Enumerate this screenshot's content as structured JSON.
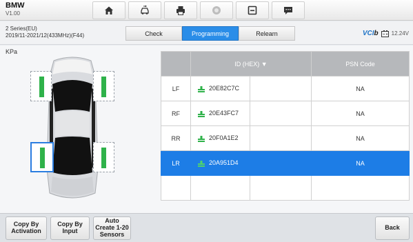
{
  "header": {
    "make": "BMW",
    "version": "V1.00",
    "toolbar": [
      {
        "name": "home-icon"
      },
      {
        "name": "vehicle-swap-icon"
      },
      {
        "name": "print-icon"
      },
      {
        "name": "help-icon"
      },
      {
        "name": "save-icon"
      },
      {
        "name": "message-icon"
      }
    ]
  },
  "vehicle": {
    "line1": "2 Series(EU)",
    "line2": "2019/11-2021/12(433MHz)(F44)"
  },
  "tabs": [
    {
      "label": "Check",
      "active": false
    },
    {
      "label": "Programming",
      "active": true
    },
    {
      "label": "Relearn",
      "active": false
    }
  ],
  "status": {
    "vci_label": "VCI",
    "vci_b": "b",
    "voltage": "12.24V"
  },
  "main": {
    "unit": "KPa"
  },
  "table": {
    "headers": [
      "",
      "ID (HEX) ▼",
      "PSN Code"
    ],
    "rows": [
      {
        "pos": "LF",
        "id": "20E82C7C",
        "psn": "NA"
      },
      {
        "pos": "RF",
        "id": "20E43FC7",
        "psn": "NA"
      },
      {
        "pos": "RR",
        "id": "20F0A1E2",
        "psn": "NA"
      },
      {
        "pos": "LR",
        "id": "20A951D4",
        "psn": "NA"
      }
    ]
  },
  "footer": {
    "copy_activation": "Copy By Activation",
    "copy_input": "Copy By Input",
    "auto_create": "Auto Create 1-20 Sensors",
    "back": "Back"
  },
  "colors": {
    "accent": "#2a8de8",
    "selected_row": "#1d7de6",
    "sensor_ok": "#2fb24a"
  }
}
